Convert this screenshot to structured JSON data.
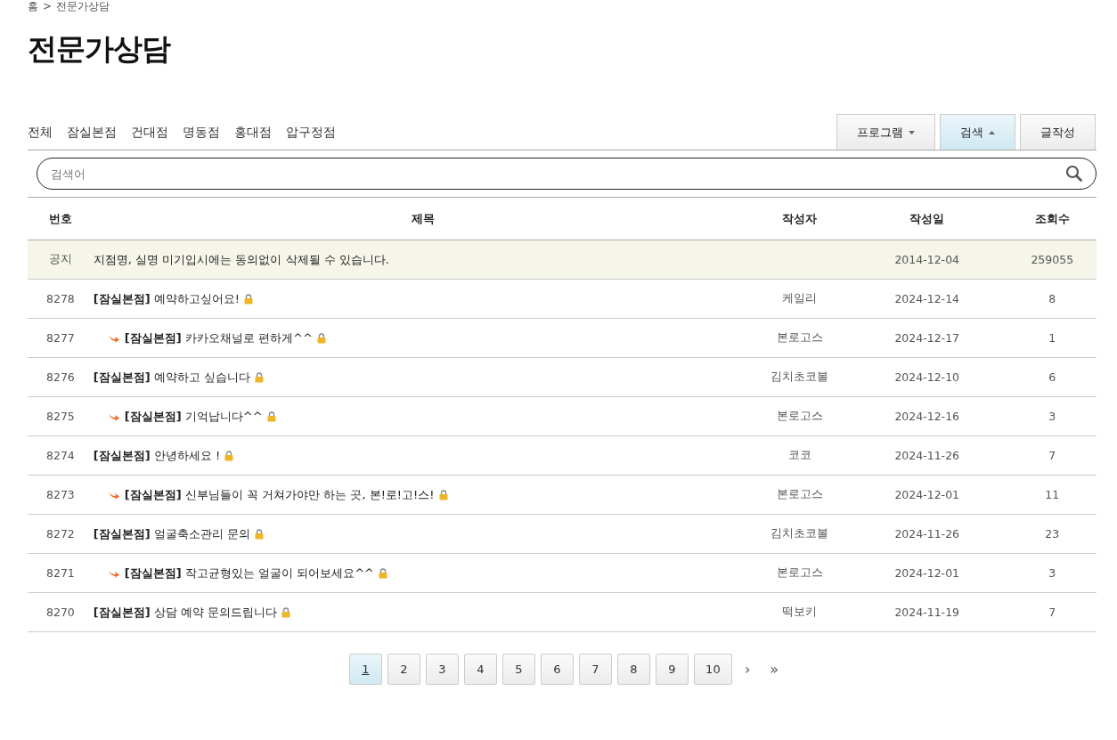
{
  "breadcrumb": {
    "home": "홈",
    "separator": ">",
    "current": "전문가상담"
  },
  "page_title": "전문가상담",
  "branch_tabs": [
    {
      "label": "전체"
    },
    {
      "label": "잠실본점"
    },
    {
      "label": "건대점"
    },
    {
      "label": "명동점"
    },
    {
      "label": "홍대점"
    },
    {
      "label": "압구정점"
    }
  ],
  "toolbar_buttons": [
    {
      "label": "프로그램",
      "kind": "dropdown",
      "expanded": false
    },
    {
      "label": "검색",
      "kind": "dropdown",
      "expanded": true
    },
    {
      "label": "글작성",
      "kind": "button"
    }
  ],
  "search": {
    "placeholder": "검색어"
  },
  "table": {
    "columns": [
      "번호",
      "제목",
      "작성자",
      "작성일",
      "조회수"
    ],
    "rows": [
      {
        "kind": "notice",
        "number": "공지",
        "title": "지점명, 실명 미기입시에는 동의없이 삭제될 수 있습니다.",
        "date": "2014-12-04",
        "views": "259055"
      },
      {
        "kind": "post",
        "number": "8278",
        "title": "**[잠실본점]** 예약하고싶어요!",
        "reply": false,
        "locked": true,
        "author": "케일리",
        "date": "2024-12-14",
        "views": "8"
      },
      {
        "kind": "post",
        "number": "8277",
        "title": "**[잠실본점]** 카카오채널로 편하게^^",
        "reply": true,
        "locked": true,
        "author": "본로고스",
        "date": "2024-12-17",
        "views": "1"
      },
      {
        "kind": "post",
        "number": "8276",
        "title": "**[잠실본점]** 예약하고 싶습니다",
        "reply": false,
        "locked": true,
        "author": "김치초코볼",
        "date": "2024-12-10",
        "views": "6"
      },
      {
        "kind": "post",
        "number": "8275",
        "title": "**[잠실본점]** 기억납니다^^",
        "reply": true,
        "locked": true,
        "author": "본로고스",
        "date": "2024-12-16",
        "views": "3"
      },
      {
        "kind": "post",
        "number": "8274",
        "title": "**[잠실본점]** 안녕하세요 !",
        "reply": false,
        "locked": true,
        "author": "코코",
        "date": "2024-11-26",
        "views": "7"
      },
      {
        "kind": "post",
        "number": "8273",
        "title": "**[잠실본점]** 신부님들이 꼭 거쳐가야만 하는 곳, 본!로!고!스!",
        "reply": true,
        "locked": true,
        "author": "본로고스",
        "date": "2024-12-01",
        "views": "11"
      },
      {
        "kind": "post",
        "number": "8272",
        "title": "**[잠실본점]** 얼굴축소관리 문의",
        "reply": false,
        "locked": true,
        "author": "김치초코볼",
        "date": "2024-11-26",
        "views": "23"
      },
      {
        "kind": "post",
        "number": "8271",
        "title": "**[잠실본점]** 작고균형있는 얼굴이 되어보세요^^",
        "reply": true,
        "locked": true,
        "author": "본로고스",
        "date": "2024-12-01",
        "views": "3"
      },
      {
        "kind": "post",
        "number": "8270",
        "title": "**[잠실본점]** 상담 예약 문의드립니다",
        "reply": false,
        "locked": true,
        "author": "떡보키",
        "date": "2024-11-19",
        "views": "7"
      }
    ]
  },
  "pagination": {
    "pages": [
      {
        "label": "1",
        "selected": true
      },
      {
        "label": "2",
        "selected": false
      },
      {
        "label": "3",
        "selected": false
      },
      {
        "label": "4",
        "selected": false
      },
      {
        "label": "5",
        "selected": false
      },
      {
        "label": "6",
        "selected": false
      },
      {
        "label": "7",
        "selected": false
      },
      {
        "label": "8",
        "selected": false
      },
      {
        "label": "9",
        "selected": false
      },
      {
        "label": "10",
        "selected": false
      }
    ],
    "next": "›",
    "last": "»"
  }
}
